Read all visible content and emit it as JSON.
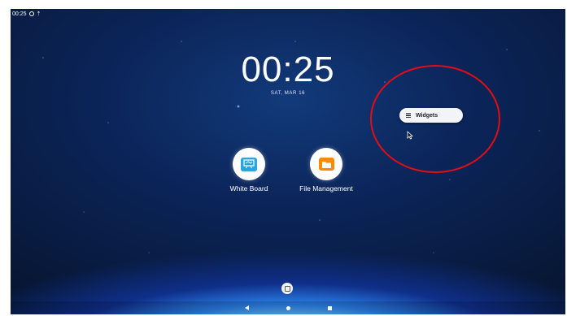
{
  "status_bar": {
    "time": "00:25",
    "icons": [
      "settings-dot-icon",
      "signal-icon"
    ]
  },
  "lockscreen": {
    "clock": "00:25",
    "date": "SAT, MAR 16"
  },
  "apps": [
    {
      "label": "White Board",
      "icon": "whiteboard-icon",
      "color": "#27a6de"
    },
    {
      "label": "File Management",
      "icon": "folder-icon",
      "color": "#ff8a00"
    }
  ],
  "popup_menu": {
    "widgets_label": "Widgets",
    "widgets_icon": "widgets-list-icon"
  },
  "annotation": {
    "color": "#e50c13"
  },
  "nav": {
    "back_icon": "back-icon",
    "home_icon": "home-icon",
    "recent_icon": "recent-apps-icon"
  }
}
